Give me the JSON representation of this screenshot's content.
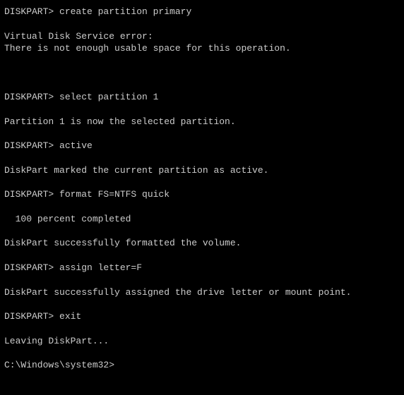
{
  "terminal": {
    "blocks": [
      {
        "lines": [
          "DISKPART> create partition primary"
        ]
      },
      {
        "lines": [
          "Virtual Disk Service error:",
          "There is not enough usable space for this operation."
        ]
      },
      {
        "lines": [
          ""
        ]
      },
      {
        "lines": [
          "DISKPART> select partition 1"
        ]
      },
      {
        "lines": [
          "Partition 1 is now the selected partition."
        ]
      },
      {
        "lines": [
          "DISKPART> active"
        ]
      },
      {
        "lines": [
          "DiskPart marked the current partition as active."
        ]
      },
      {
        "lines": [
          "DISKPART> format FS=NTFS quick"
        ]
      },
      {
        "lines": [
          "  100 percent completed"
        ]
      },
      {
        "lines": [
          "DiskPart successfully formatted the volume."
        ]
      },
      {
        "lines": [
          "DISKPART> assign letter=F"
        ]
      },
      {
        "lines": [
          "DiskPart successfully assigned the drive letter or mount point."
        ]
      },
      {
        "lines": [
          "DISKPART> exit"
        ]
      },
      {
        "lines": [
          "Leaving DiskPart..."
        ]
      },
      {
        "lines": [
          "C:\\Windows\\system32>"
        ]
      }
    ]
  }
}
